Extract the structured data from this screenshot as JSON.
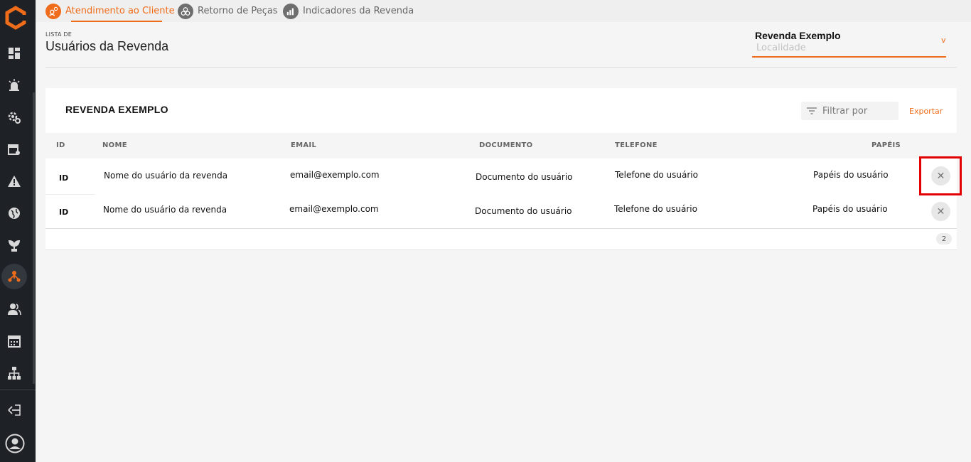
{
  "tabs": [
    {
      "label": "Atendimento ao Cliente",
      "active": true,
      "icon": "customer-service-icon"
    },
    {
      "label": "Retorno de Peças",
      "active": false,
      "icon": "parts-return-icon"
    },
    {
      "label": "Indicadores da Revenda",
      "active": false,
      "icon": "indicators-icon"
    }
  ],
  "header": {
    "eyebrow": "LISTA DE",
    "title": "Usuários da Revenda"
  },
  "reseller": {
    "name": "Revenda Exemplo",
    "placeholder": "Localidade",
    "chevron": "v"
  },
  "card": {
    "title": "REVENDA EXEMPLO",
    "filter_placeholder": "Filtrar por",
    "export_label": "Exportar"
  },
  "columns": [
    "ID",
    "NOME",
    "EMAIL",
    "DOCUMENTO",
    "TELEFONE",
    "PAPÉIS"
  ],
  "rows": [
    {
      "id": "ID",
      "name": "Nome do usuário da revenda",
      "email": "email@exemplo.com",
      "document": "Documento do usuário",
      "phone": "Telefone do usuário",
      "roles": "Papéis do usuário"
    },
    {
      "id": "ID",
      "name": "Nome do usuário da revenda",
      "email": "email@exemplo.com",
      "document": "Documento do usuário",
      "phone": "Telefone do usuário",
      "roles": "Papéis do usuário"
    }
  ],
  "pagination": {
    "count": "2"
  },
  "delete_glyph": "✕",
  "colors": {
    "accent": "#ef6c1a",
    "sidebar": "#1e2126",
    "highlight": "#e30000"
  }
}
